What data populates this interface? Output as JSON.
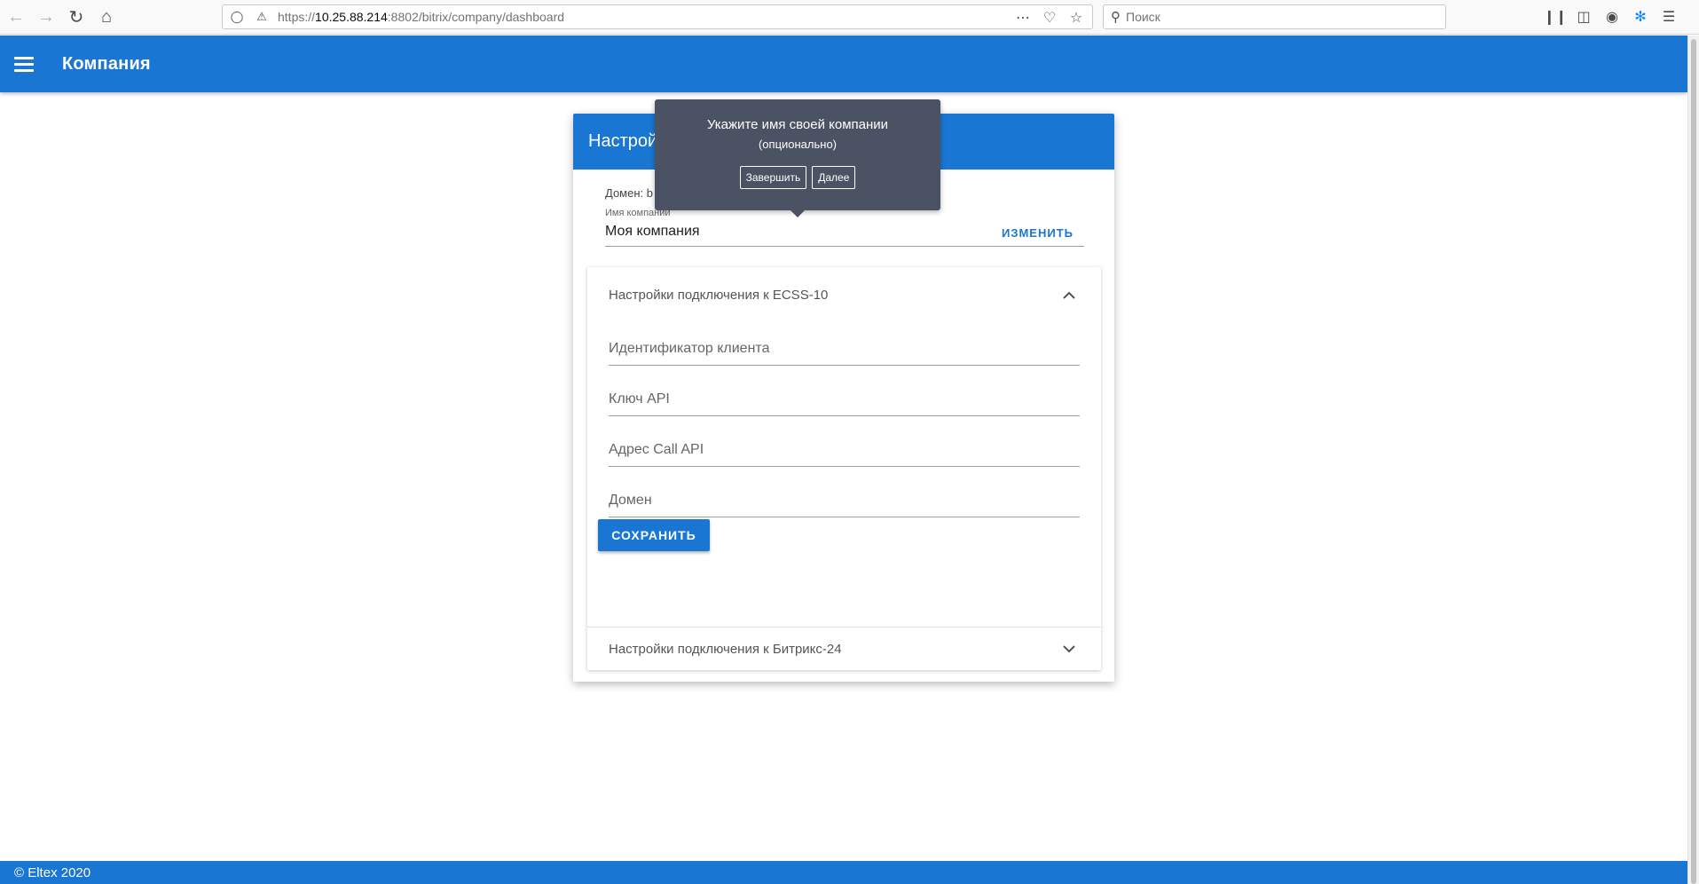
{
  "browser": {
    "url_prefix": "https://",
    "url_host": "10.25.88.214",
    "url_rest": ":8802/bitrix/company/dashboard",
    "search_placeholder": "Поиск"
  },
  "app_bar": {
    "title": "Компания"
  },
  "card": {
    "header_title": "Настройки",
    "domain_label": "Домен: b",
    "company_name_label": "Имя компании",
    "company_name_value": "Моя компания",
    "change_label": "ИЗМЕНИТЬ"
  },
  "panels": {
    "ecss": {
      "title": "Настройки подключения к ECSS-10",
      "fields": {
        "client_id": "Идентификатор клиента",
        "api_key": "Ключ API",
        "call_api_address": "Адрес Call API",
        "domain": "Домен"
      },
      "save_label": "СОХРАНИТЬ"
    },
    "bitrix": {
      "title": "Настройки подключения к Битрикс-24"
    }
  },
  "tooltip": {
    "title": "Укажите имя своей компании",
    "subtitle": "(опционально)",
    "finish_label": "Завершить",
    "next_label": "Далее"
  },
  "footer": {
    "text": "© Eltex 2020"
  },
  "colors": {
    "primary": "#1976d2",
    "tooltip_bg": "#4b5263"
  }
}
